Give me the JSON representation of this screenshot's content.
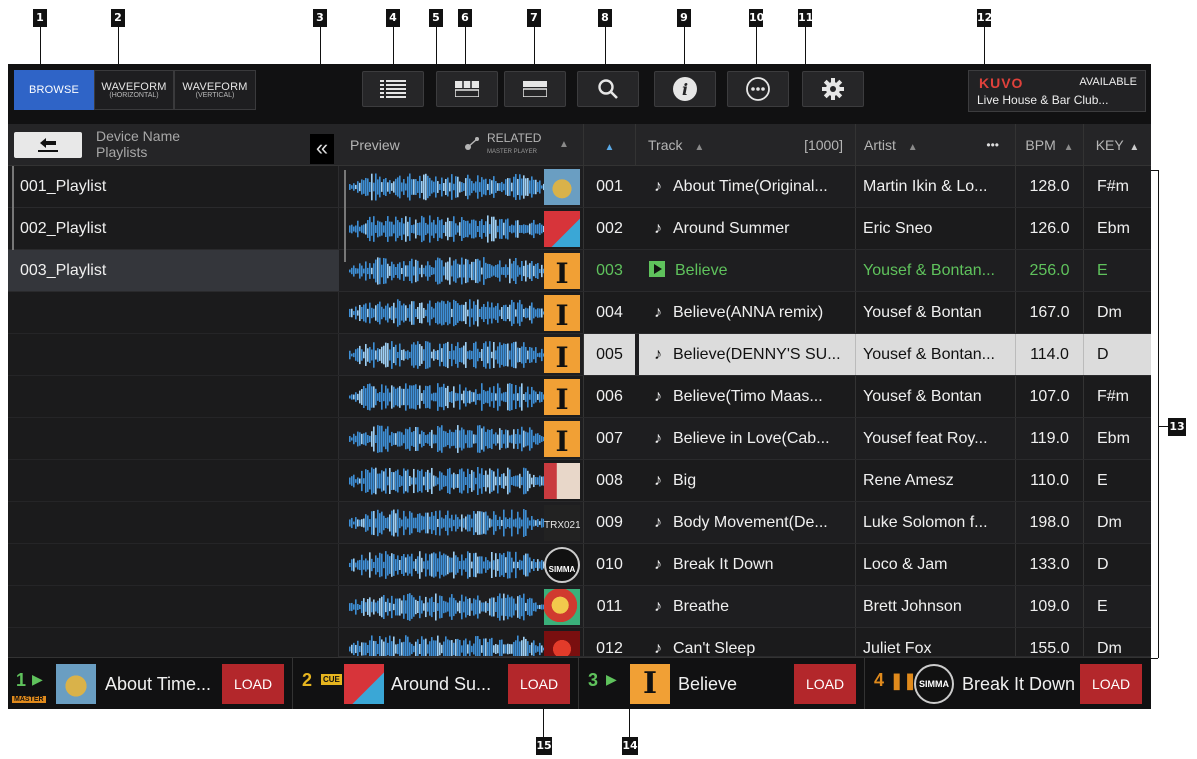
{
  "callouts": [
    "1",
    "2",
    "3",
    "4",
    "5",
    "6",
    "7",
    "8",
    "9",
    "10",
    "11",
    "12",
    "13",
    "14",
    "15"
  ],
  "topbar": {
    "browse": "BROWSE",
    "wave_h_main": "WAVEFORM",
    "wave_h_sub": "(HORIZONTAL)",
    "wave_v_main": "WAVEFORM",
    "wave_v_sub": "(VERTICAL)",
    "kuvo_logo": "KUVO",
    "kuvo_status": "AVAILABLE",
    "kuvo_venue": "Live House & Bar Club..."
  },
  "left_panel": {
    "device_name": "Device Name",
    "subtitle": "Playlists",
    "collapse_glyph": "«",
    "playlists": [
      "001_Playlist",
      "002_Playlist",
      "003_Playlist"
    ]
  },
  "list_header": {
    "preview": "Preview",
    "related": "RELATED",
    "related_sub": "MASTER PLAYER",
    "track": "Track",
    "count": "[1000]",
    "artist": "Artist",
    "more": "•••",
    "bpm": "BPM",
    "key": "KEY"
  },
  "tracks": [
    {
      "num": "001",
      "title": "About Time(Original...",
      "artist": "Martin Ikin & Lo...",
      "bpm": "128.0",
      "key": "F#m"
    },
    {
      "num": "002",
      "title": "Around Summer",
      "artist": "Eric Sneo",
      "bpm": "126.0",
      "key": "Ebm"
    },
    {
      "num": "003",
      "title": "Believe",
      "artist": "Yousef & Bontan...",
      "bpm": "256.0",
      "key": "E"
    },
    {
      "num": "004",
      "title": "Believe(ANNA remix)",
      "artist": "Yousef & Bontan",
      "bpm": "167.0",
      "key": "Dm"
    },
    {
      "num": "005",
      "title": "Believe(DENNY'S SU...",
      "artist": "Yousef & Bontan...",
      "bpm": "114.0",
      "key": "D"
    },
    {
      "num": "006",
      "title": "Believe(Timo Maas...",
      "artist": "Yousef & Bontan",
      "bpm": "107.0",
      "key": "F#m"
    },
    {
      "num": "007",
      "title": "Believe in Love(Cab...",
      "artist": "Yousef feat Roy...",
      "bpm": "119.0",
      "key": "Ebm"
    },
    {
      "num": "008",
      "title": "Big",
      "artist": "Rene Amesz",
      "bpm": "110.0",
      "key": "E"
    },
    {
      "num": "009",
      "title": "Body Movement(De...",
      "artist": "Luke Solomon f...",
      "bpm": "198.0",
      "key": "Dm"
    },
    {
      "num": "010",
      "title": "Break It Down",
      "artist": "Loco & Jam",
      "bpm": "133.0",
      "key": "D"
    },
    {
      "num": "011",
      "title": "Breathe",
      "artist": "Brett Johnson",
      "bpm": "109.0",
      "key": "E"
    },
    {
      "num": "012",
      "title": "Can't Sleep",
      "artist": "Juliet Fox",
      "bpm": "155.0",
      "key": "Dm"
    }
  ],
  "art_labels": {
    "trx": "TRX021",
    "simma": "SIMMA",
    "I": "I"
  },
  "decks": [
    {
      "num": "1",
      "title": "About Time...",
      "tag": "MASTER",
      "load": "LOAD"
    },
    {
      "num": "2",
      "title": "Around Su...",
      "tag": "CUE",
      "load": "LOAD"
    },
    {
      "num": "3",
      "title": "Believe",
      "load": "LOAD"
    },
    {
      "num": "4",
      "title": "Break It Down",
      "load": "LOAD"
    }
  ],
  "colors": {
    "accent_blue": "#2f64c7",
    "playing_green": "#5fc25c",
    "load_red": "#b3272b",
    "kuvo_red": "#e0413b"
  }
}
